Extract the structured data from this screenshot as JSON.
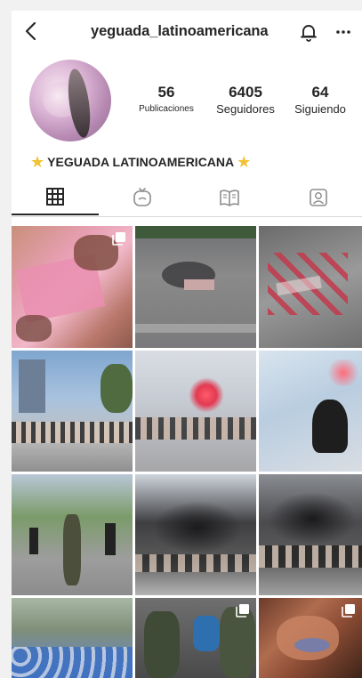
{
  "header": {
    "username": "yeguada_latinoamericana"
  },
  "profile": {
    "posts_count": "56",
    "posts_label": "Publicaciones",
    "followers_count": "6405",
    "followers_label": "Seguidores",
    "following_count": "64",
    "following_label": "Siguiendo",
    "bio": "YEGUADA LATINOAMERICANA"
  },
  "tabs": [
    {
      "icon": "grid-icon",
      "active": true
    },
    {
      "icon": "reels-tv-icon",
      "active": false
    },
    {
      "icon": "guide-book-icon",
      "active": false
    },
    {
      "icon": "tagged-person-icon",
      "active": false
    }
  ],
  "grid": {
    "tiles": [
      {
        "desc": "pink-painted-paper-protest",
        "multiple": true
      },
      {
        "desc": "aerial-street-crowd",
        "multiple": false
      },
      {
        "desc": "red-performers-aerial",
        "multiple": false
      },
      {
        "desc": "street-performance-city",
        "multiple": false
      },
      {
        "desc": "red-smoke-flare-performance",
        "multiple": false
      },
      {
        "desc": "masked-performer-smoke",
        "multiple": false
      },
      {
        "desc": "police-officer-street",
        "multiple": false
      },
      {
        "desc": "black-smoke-performance",
        "multiple": false
      },
      {
        "desc": "performers-smoke-crouching",
        "multiple": false
      },
      {
        "desc": "crowd-blue-shapes",
        "multiple": false
      },
      {
        "desc": "police-with-child",
        "multiple": true
      },
      {
        "desc": "hands-close-up",
        "multiple": true
      }
    ]
  }
}
